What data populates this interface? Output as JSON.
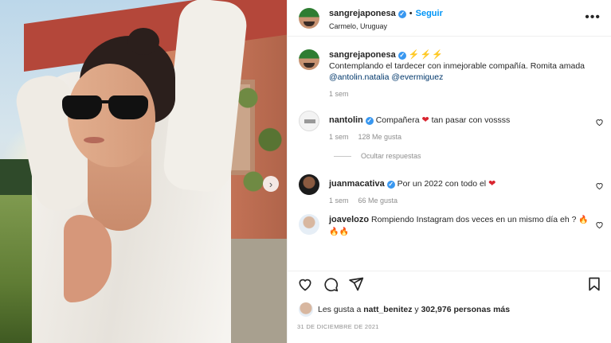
{
  "post": {
    "username": "sangrejaponesa",
    "follow_label": "Seguir",
    "separator": "•",
    "location": "Carmelo, Uruguay",
    "more_label": "•••"
  },
  "caption": {
    "username": "sangrejaponesa",
    "bolts": "⚡⚡⚡",
    "text": "Contemplando el tardecer con inmejorable compañía. Romita amada",
    "mention_1": "@antolin.natalia",
    "mention_2": "@evermiguez",
    "time": "1 sem"
  },
  "comments": [
    {
      "username": "nantolin",
      "text_before": "Compañera",
      "text_after": "tan pasar con vossss",
      "time": "1 sem",
      "likes": "128 Me gusta"
    },
    {
      "username": "juanmacativa",
      "text_before": "Por un 2022 con todo el",
      "time": "1 sem",
      "likes": "66 Me gusta"
    },
    {
      "username": "joavelozo",
      "text": "Rompiendo Instagram dos veces en un mismo día eh ?",
      "emoji": "🔥🔥🔥"
    }
  ],
  "hide_replies_label": "Ocultar respuestas",
  "likes_summary": {
    "prefix": "Les gusta a",
    "user": "natt_benitez",
    "middle": "y",
    "count": "302,976",
    "suffix": "personas más"
  },
  "date": "31 DE DICIEMBRE DE 2021",
  "icons": [
    "heart-icon",
    "comment-icon",
    "share-icon",
    "bookmark-icon",
    "chevron-right-icon",
    "verified-icon"
  ],
  "colors": {
    "link_blue": "#0095f6",
    "verified": "#3897f0",
    "heart_red": "#d9242f",
    "muted": "#8e8e8e"
  }
}
